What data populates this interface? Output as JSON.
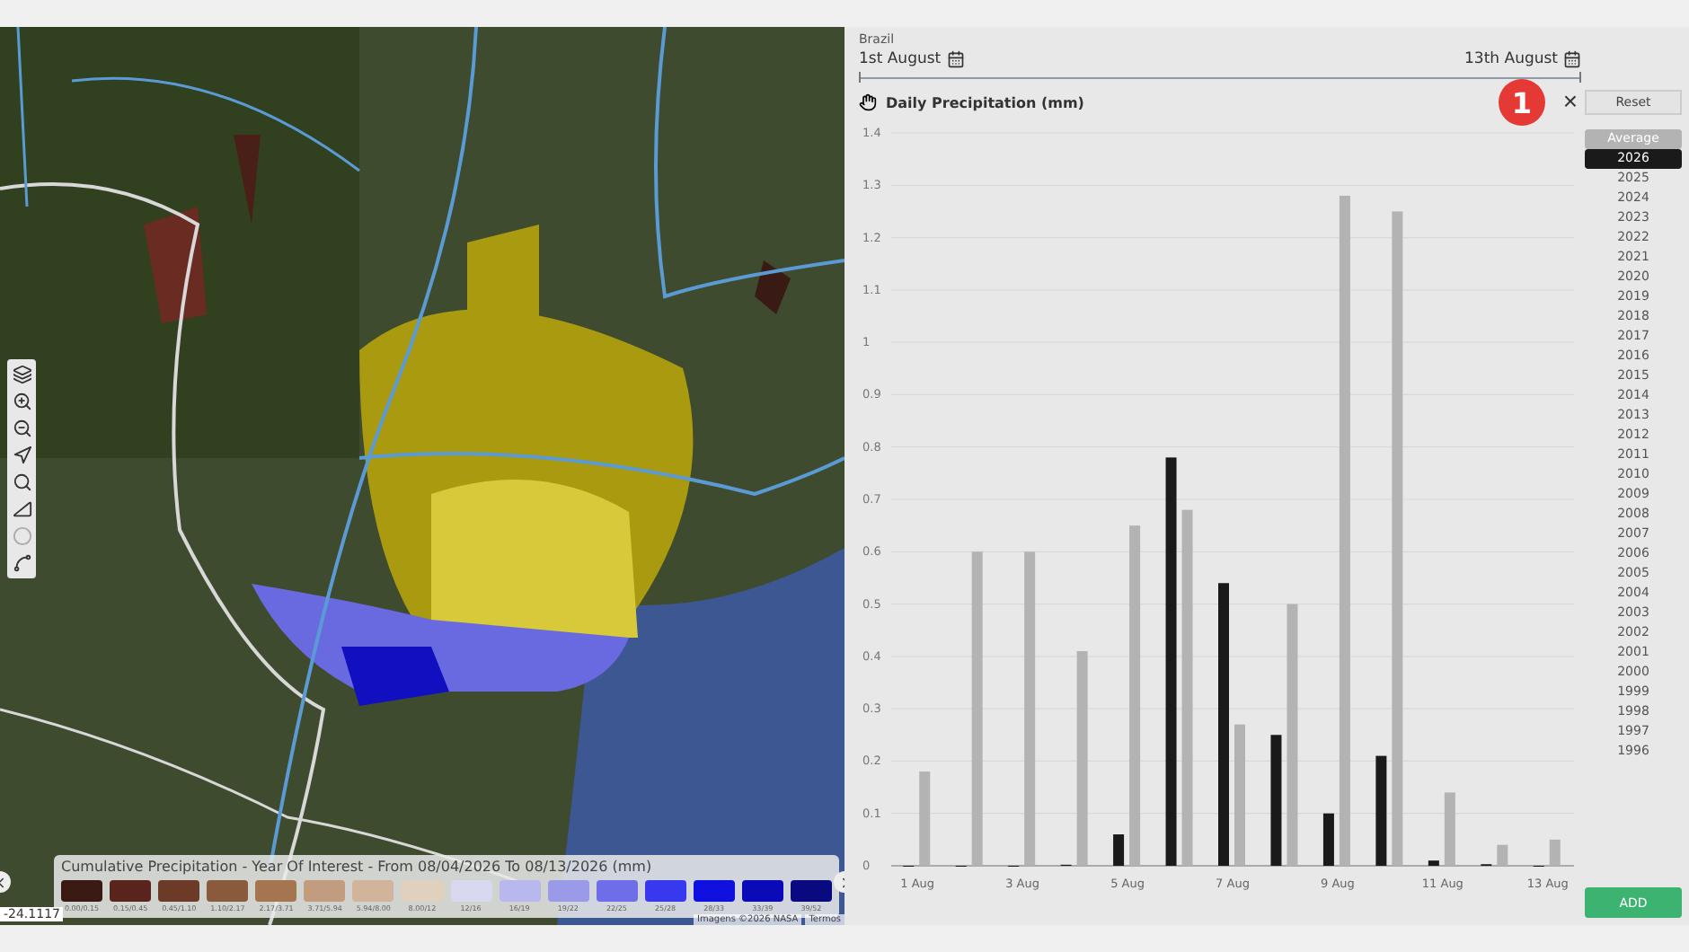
{
  "map": {
    "coordinate": "-24.1117",
    "attribution": "Imagens ©2026 NASA",
    "terms": "Termos",
    "legend": {
      "title": "Cumulative Precipitation - Year Of Interest - From 08/04/2026 To 08/13/2026 (mm)",
      "items": [
        {
          "label": "0.00/0.15",
          "color": "#3b1a14"
        },
        {
          "label": "0.15/0.45",
          "color": "#5a241c"
        },
        {
          "label": "0.45/1.10",
          "color": "#6e3a28"
        },
        {
          "label": "1.10/2.17",
          "color": "#8a5a3c"
        },
        {
          "label": "2.17/3.71",
          "color": "#a5754f"
        },
        {
          "label": "3.71/5.94",
          "color": "#c29c7e"
        },
        {
          "label": "5.94/8.00",
          "color": "#d2b49a"
        },
        {
          "label": "8.00/12",
          "color": "#e0d0bd"
        },
        {
          "label": "12/16",
          "color": "#d8d8ee"
        },
        {
          "label": "16/19",
          "color": "#b8b8ee"
        },
        {
          "label": "19/22",
          "color": "#9a9ae8"
        },
        {
          "label": "22/25",
          "color": "#6e6ee8"
        },
        {
          "label": "25/28",
          "color": "#3838ee"
        },
        {
          "label": "28/33",
          "color": "#1010e0"
        },
        {
          "label": "33/39",
          "color": "#0a0ab8"
        },
        {
          "label": "39/52",
          "color": "#0a0a80"
        }
      ]
    }
  },
  "panel": {
    "region": "Brazil",
    "start_date": "1st August",
    "end_date": "13th August",
    "chart_title": "Daily Precipitation (mm)",
    "badge": "1",
    "close": "×",
    "reset": "Reset",
    "add": "ADD",
    "chart_data": {
      "type": "bar",
      "categories": [
        "1 Aug",
        null,
        "3 Aug",
        null,
        "5 Aug",
        null,
        "7 Aug",
        null,
        "9 Aug",
        null,
        "11 Aug",
        null,
        "13 Aug"
      ],
      "grid": true,
      "ylim": [
        0,
        1.4
      ],
      "yticks": [
        0,
        0.1,
        0.2,
        0.3,
        0.4,
        0.5,
        0.6,
        0.7,
        0.8,
        0.9,
        1,
        1.1,
        1.2,
        1.3,
        1.4
      ],
      "series": [
        {
          "color": "#1a1a1a",
          "values": [
            0,
            0,
            0,
            0.002,
            0.06,
            0.78,
            0.54,
            0.25,
            0.1,
            0.21,
            0.01,
            0.003,
            0
          ]
        },
        {
          "color": "#b3b3b3",
          "values": [
            0.18,
            0.6,
            0.6,
            0.41,
            0.65,
            0.68,
            0.27,
            0.5,
            1.28,
            1.25,
            0.14,
            0.04,
            0.05
          ]
        }
      ]
    },
    "years": [
      {
        "label": "Average",
        "selected": true,
        "color": "#b3b3b3"
      },
      {
        "label": "2026",
        "selected": true,
        "color": "#1a1a1a"
      },
      {
        "label": "2025",
        "selected": false
      },
      {
        "label": "2024",
        "selected": false
      },
      {
        "label": "2023",
        "selected": false
      },
      {
        "label": "2022",
        "selected": false
      },
      {
        "label": "2021",
        "selected": false
      },
      {
        "label": "2020",
        "selected": false
      },
      {
        "label": "2019",
        "selected": false
      },
      {
        "label": "2018",
        "selected": false
      },
      {
        "label": "2017",
        "selected": false
      },
      {
        "label": "2016",
        "selected": false
      },
      {
        "label": "2015",
        "selected": false
      },
      {
        "label": "2014",
        "selected": false
      },
      {
        "label": "2013",
        "selected": false
      },
      {
        "label": "2012",
        "selected": false
      },
      {
        "label": "2011",
        "selected": false
      },
      {
        "label": "2010",
        "selected": false
      },
      {
        "label": "2009",
        "selected": false
      },
      {
        "label": "2008",
        "selected": false
      },
      {
        "label": "2007",
        "selected": false
      },
      {
        "label": "2006",
        "selected": false
      },
      {
        "label": "2005",
        "selected": false
      },
      {
        "label": "2004",
        "selected": false
      },
      {
        "label": "2003",
        "selected": false
      },
      {
        "label": "2002",
        "selected": false
      },
      {
        "label": "2001",
        "selected": false
      },
      {
        "label": "2000",
        "selected": false
      },
      {
        "label": "1999",
        "selected": false
      },
      {
        "label": "1998",
        "selected": false
      },
      {
        "label": "1997",
        "selected": false
      },
      {
        "label": "1996",
        "selected": false
      }
    ]
  }
}
